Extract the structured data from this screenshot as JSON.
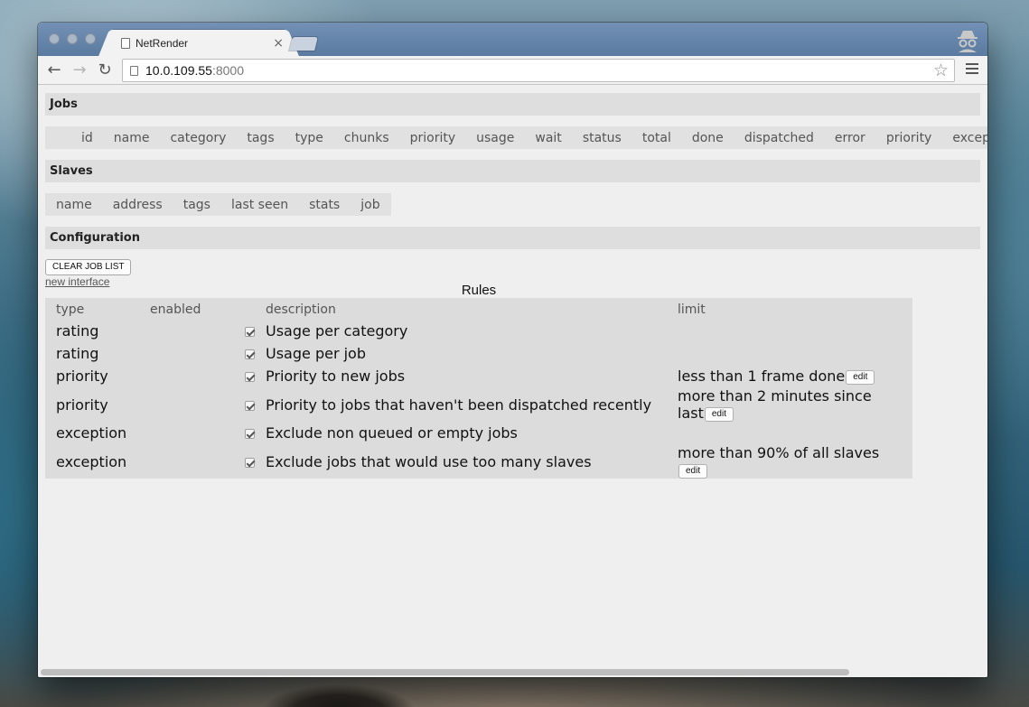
{
  "browser": {
    "tab_title": "NetRender",
    "tab_close": "×",
    "url_host": "10.0.109.55",
    "url_port": ":8000",
    "back_glyph": "←",
    "forward_glyph": "→",
    "reload_glyph": "↻",
    "star_glyph": "☆",
    "icons": [
      "page-icon",
      "close-icon",
      "incognito-icon",
      "star-icon",
      "menu-icon"
    ]
  },
  "sections": {
    "jobs_title": "Jobs",
    "slaves_title": "Slaves",
    "config_title": "Configuration"
  },
  "jobs_columns": [
    "id",
    "name",
    "category",
    "tags",
    "type",
    "chunks",
    "priority",
    "usage",
    "wait",
    "status",
    "total",
    "done",
    "dispatched",
    "error",
    "priority",
    "exception"
  ],
  "slaves_columns": [
    "name",
    "address",
    "tags",
    "last seen",
    "stats",
    "job"
  ],
  "config": {
    "clear_button": "CLEAR JOB LIST",
    "new_interface_link": "new interface"
  },
  "rules": {
    "caption": "Rules",
    "headers": {
      "type": "type",
      "enabled": "enabled",
      "description": "description",
      "limit": "limit"
    },
    "edit_label": "edit",
    "rows": [
      {
        "type": "rating",
        "enabled": true,
        "description": "Usage per category",
        "limit": ""
      },
      {
        "type": "rating",
        "enabled": true,
        "description": "Usage per job",
        "limit": ""
      },
      {
        "type": "priority",
        "enabled": true,
        "description": "Priority to new jobs",
        "limit": "less than 1 frame done"
      },
      {
        "type": "priority",
        "enabled": true,
        "description": "Priority to jobs that haven't been dispatched recently",
        "limit": "more than 2 minutes since last"
      },
      {
        "type": "exception",
        "enabled": true,
        "description": "Exclude non queued or empty jobs",
        "limit": ""
      },
      {
        "type": "exception",
        "enabled": true,
        "description": "Exclude jobs that would use too many slaves",
        "limit": "more than 90% of all slaves"
      }
    ]
  }
}
